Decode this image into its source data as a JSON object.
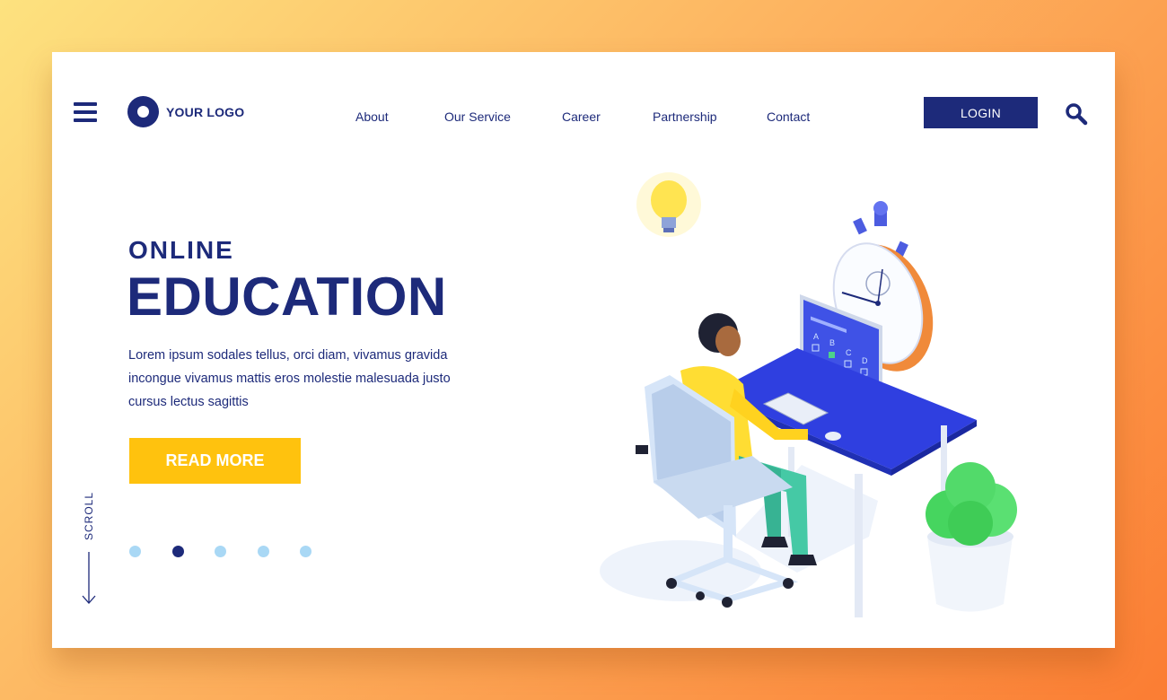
{
  "header": {
    "logo_text": "YOUR LOGO",
    "nav": [
      {
        "label": "About"
      },
      {
        "label": "Our Service"
      },
      {
        "label": "Career"
      },
      {
        "label": "Partnership"
      },
      {
        "label": "Contact"
      }
    ],
    "login_label": "LOGIN",
    "icons": {
      "menu": "hamburger-menu-icon",
      "search": "search-icon",
      "logo": "logo-mark-icon"
    }
  },
  "hero": {
    "kicker": "ONLINE",
    "headline": "EDUCATION",
    "description": "Lorem ipsum sodales tellus, orci diam, vivamus gravida incongue vivamus mattis eros molestie malesuada justo cursus lectus sagittis",
    "cta_label": "READ MORE"
  },
  "scroll": {
    "label": "SCROLL"
  },
  "pagination": {
    "count": 5,
    "active_index": 1
  },
  "illustration": {
    "screen_options": [
      "A",
      "B",
      "C",
      "D"
    ]
  },
  "colors": {
    "brand_navy": "#1d2a7a",
    "cta_yellow": "#ffc20e",
    "desk_blue": "#2f3fe0",
    "dot_light": "#a9d8f5",
    "bg_gradient_start": "#fde27f",
    "bg_gradient_end": "#fb7d33"
  }
}
